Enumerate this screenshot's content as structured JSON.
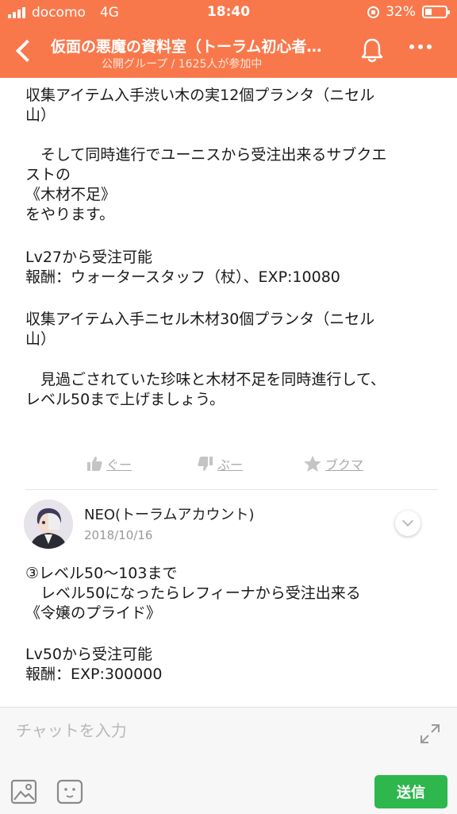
{
  "status_bar": {
    "carrier": "docomo",
    "network": "4G",
    "time": "18:40",
    "battery_percent": "32%",
    "battery_level": 0.32
  },
  "header": {
    "title": "仮面の悪魔の資料室（トーラム初心者…",
    "subtitle": "公開グループ / 1625人が参加中",
    "back_icon": "chevron-left-icon",
    "bell_icon": "bell-icon",
    "more_icon": "more-horizontal-icon"
  },
  "post": {
    "paragraphs": [
      "収集アイテム入手渋い木の実12個プランタ（ニセル\n山）",
      "　そして同時進行でユーニスから受注出来るサブクエ\nストの\n《木材不足》\nをやります。",
      "Lv27から受注可能\n報酬：ウォータースタッフ（杖）、EXP:10080",
      "収集アイテム入手ニセル木材30個プランタ（ニセル\n山）",
      "　見過ごされていた珍味と木材不足を同時進行して、\nレベル50まで上げましょう。"
    ],
    "actions": {
      "like": "ぐー",
      "dislike": "ぶー",
      "bookmark": "ブクマ"
    }
  },
  "comment": {
    "author": "NEO(トーラムアカウント)",
    "date": "2018/10/16",
    "paragraphs": [
      "③レベル50〜103まで\n　レベル50になったらレフィーナから受注出来る\n《令嬢のプライド》",
      "Lv50から受注可能\n報酬：EXP:300000"
    ]
  },
  "composer": {
    "placeholder": "チャットを入力",
    "send_label": "送信"
  },
  "colors": {
    "header": "#f9784b",
    "send_button": "#2db74d",
    "muted": "#aaaaaa"
  }
}
